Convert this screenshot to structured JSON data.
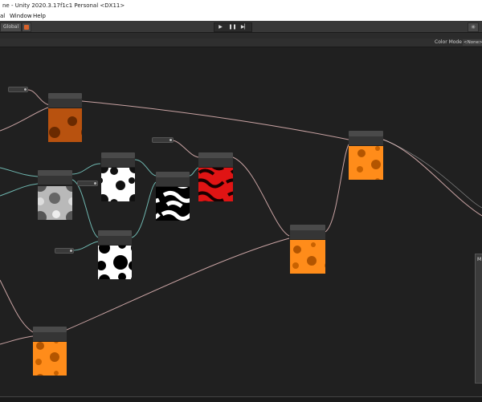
{
  "window": {
    "title": "ne - Unity 2020.3.17f1c1 Personal <DX11>"
  },
  "menu": {
    "items": [
      "al",
      "Window",
      "Help"
    ]
  },
  "toolbar": {
    "global_label": "Global",
    "play_icon": "▶",
    "pause_icon": "❚❚",
    "step_icon": "▶▏",
    "right_icon": "✳"
  },
  "graph_view": {
    "color_mode_label": "Color Mode",
    "color_mode_value": "<None>"
  },
  "side_panel": {
    "label": "M"
  },
  "colors": {
    "accent_orange": "#d9622b",
    "edge_color": "#c9a3a3",
    "edge_teal": "#6fb7b0",
    "graph_bg": "#202020"
  }
}
